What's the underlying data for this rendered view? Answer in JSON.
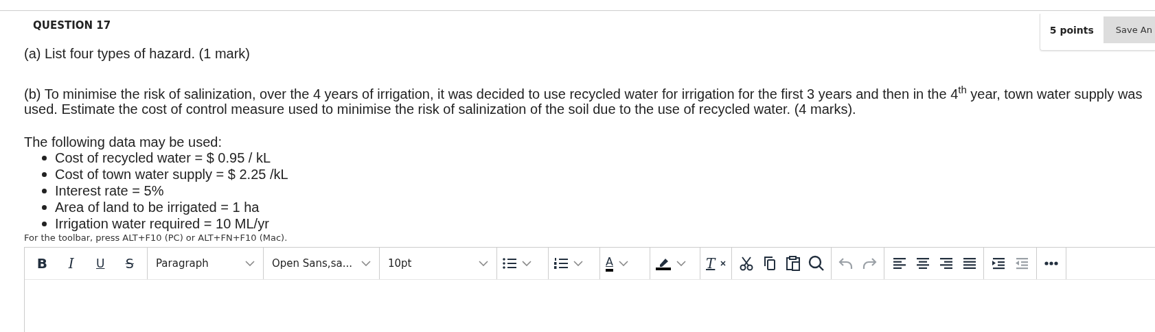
{
  "question": {
    "title": "QUESTION 17",
    "points": "5 points",
    "save_button": "Save An"
  },
  "part_a": "(a) List four types of hazard. (1 mark)",
  "part_b": "(b) To minimise the risk of salinization, over the 4 years of irrigation, it was decided to use recycled water for irrigation for the first 3 years and then in the 4$^{th}$ year, town water supply was used. Estimate the cost of control measure used to minimise the risk of salinization of the soil due to the use of recycled water. (4 marks).",
  "data_intro": "The following data may be used:",
  "data_items": [
    "Cost of recycled water = $ 0.95 / kL",
    "Cost of town water supply = $ 2.25 /kL",
    "Interest rate = 5%",
    "Area of land to be irrigated = 1 ha",
    "Irrigation water required = 10 ML/yr"
  ],
  "toolbar_hint": "For the toolbar, press ALT+F10 (PC) or ALT+FN+F10 (Mac).",
  "toolbar": [
    {
      "tools": [
        {
          "kind": "bold",
          "label": "B",
          "disabled": false
        },
        {
          "kind": "italic",
          "label": "I",
          "disabled": false
        },
        {
          "kind": "underline",
          "label": "U",
          "disabled": false
        },
        {
          "kind": "strike",
          "label": "S",
          "disabled": false
        }
      ]
    },
    {
      "tools": [
        {
          "kind": "dropdown",
          "label": "Paragraph",
          "disabled": false
        }
      ]
    },
    {
      "tools": [
        {
          "kind": "dropdown",
          "label": "Open Sans,sa...",
          "disabled": false
        }
      ]
    },
    {
      "tools": [
        {
          "kind": "dropdown",
          "label": "10pt",
          "disabled": false
        }
      ]
    },
    {
      "tools": [
        {
          "kind": "bullets",
          "disabled": false
        }
      ]
    },
    {
      "tools": [
        {
          "kind": "numbers",
          "disabled": false
        }
      ]
    },
    {
      "tools": [
        {
          "kind": "textcolor",
          "label": "A",
          "disabled": false
        }
      ]
    },
    {
      "tools": [
        {
          "kind": "highlight",
          "disabled": false
        }
      ]
    },
    {
      "tools": [
        {
          "kind": "clear",
          "label": "T",
          "disabled": false
        }
      ]
    },
    {
      "tools": [
        {
          "kind": "cut",
          "disabled": false
        },
        {
          "kind": "copy",
          "disabled": false
        },
        {
          "kind": "paste",
          "disabled": false
        },
        {
          "kind": "search",
          "disabled": false
        }
      ]
    },
    {
      "tools": [
        {
          "kind": "undo",
          "disabled": true
        },
        {
          "kind": "redo",
          "disabled": true
        }
      ]
    },
    {
      "tools": [
        {
          "kind": "align-left",
          "disabled": false
        },
        {
          "kind": "align-center",
          "disabled": false
        },
        {
          "kind": "align-right",
          "disabled": false
        },
        {
          "kind": "justify",
          "disabled": false
        }
      ]
    },
    {
      "tools": [
        {
          "kind": "indent",
          "disabled": false
        },
        {
          "kind": "outdent",
          "disabled": true
        }
      ]
    },
    {
      "tools": [
        {
          "kind": "more",
          "disabled": false
        }
      ]
    }
  ]
}
